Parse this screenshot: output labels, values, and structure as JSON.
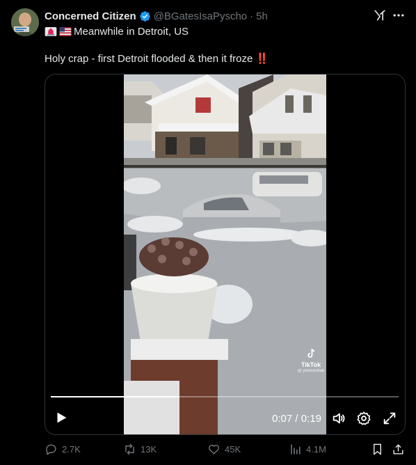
{
  "author": {
    "display_name": "Concerned Citizen",
    "handle": "@BGatesIsaPyscho",
    "separator": "·",
    "time": "5h"
  },
  "post": {
    "location_line": "Meanwhile in Detroit, US",
    "text": "Holy crap - first Detroit flooded & then it froze",
    "exclaim": "‼️"
  },
  "video": {
    "current_time": "0:07",
    "duration": "0:19",
    "time_separator": " / ",
    "progress": 0.37,
    "watermark_brand": "TikTok",
    "watermark_user": "@ yenisevilla8"
  },
  "actions": {
    "replies": "2.7K",
    "reposts": "13K",
    "likes": "45K",
    "views": "4.1M"
  },
  "colors": {
    "background": "#000000",
    "text_primary": "#e7e9ea",
    "text_secondary": "#71767b",
    "verified_blue": "#1d9bf0",
    "exclaim_red": "#f4212e"
  },
  "icons": [
    "verified-badge-icon",
    "grok-icon",
    "more-icon",
    "siren-icon",
    "us-flag-icon",
    "play-icon",
    "volume-icon",
    "settings-icon",
    "fullscreen-icon",
    "reply-icon",
    "repost-icon",
    "like-icon",
    "views-icon",
    "bookmark-icon",
    "share-icon"
  ]
}
